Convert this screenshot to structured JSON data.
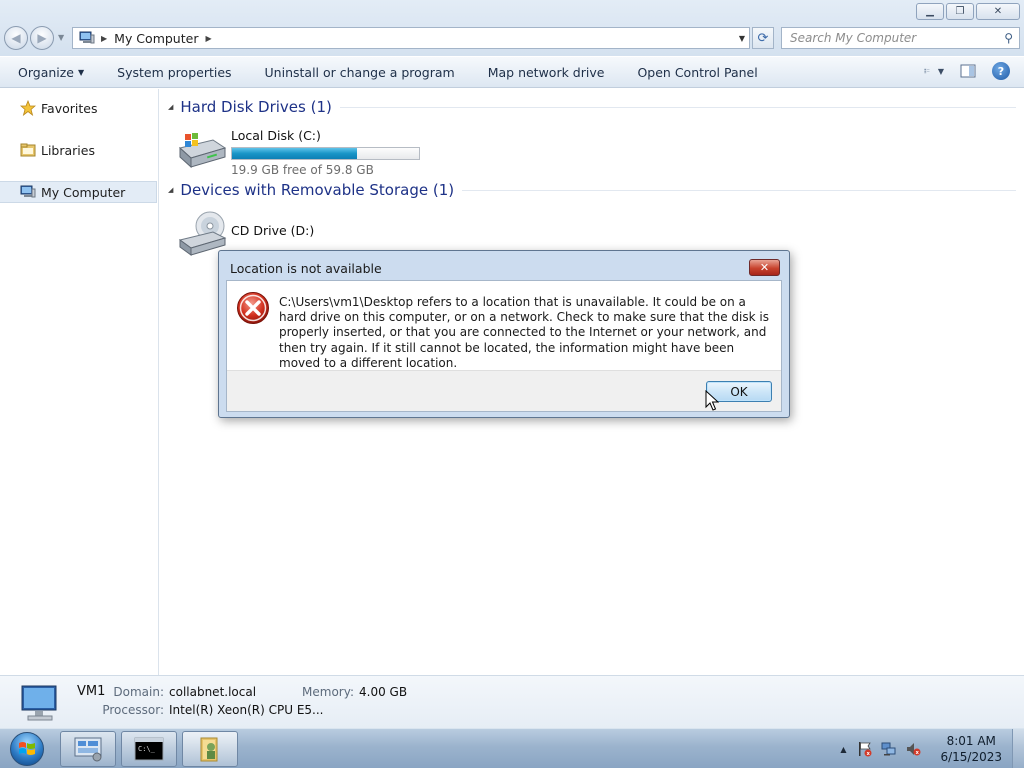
{
  "window": {
    "controls": {
      "minimize_icon": "minimize-icon",
      "restore_icon": "restore-icon",
      "close_icon": "close-icon"
    }
  },
  "address": {
    "path": "My Computer",
    "search_placeholder": "Search My Computer"
  },
  "toolbar": {
    "organize": "Organize",
    "system_properties": "System properties",
    "uninstall": "Uninstall or change a program",
    "map_drive": "Map network drive",
    "control_panel": "Open Control Panel"
  },
  "sidebar": {
    "items": [
      {
        "label": "Favorites",
        "icon": "star-icon"
      },
      {
        "label": "Libraries",
        "icon": "folder-icon"
      },
      {
        "label": "My Computer",
        "icon": "computer-icon",
        "selected": true
      }
    ]
  },
  "groups": {
    "hard_disks": {
      "title": "Hard Disk Drives (1)",
      "drives": [
        {
          "name": "Local Disk (C:)",
          "free_text": "19.9 GB free of 59.8 GB",
          "used_fraction": 0.667
        }
      ]
    },
    "removable": {
      "title": "Devices with Removable Storage (1)",
      "drives": [
        {
          "name": "CD Drive (D:)"
        }
      ]
    }
  },
  "details": {
    "name": "VM1",
    "domain_label": "Domain:",
    "domain_value": "collabnet.local",
    "memory_label": "Memory:",
    "memory_value": "4.00 GB",
    "processor_label": "Processor:",
    "processor_value": "Intel(R) Xeon(R) CPU E5..."
  },
  "dialog": {
    "title": "Location is not available",
    "message": "C:\\Users\\vm1\\Desktop refers to a location that is unavailable. It could be on a hard drive on this computer, or on a network. Check to make sure that the disk is properly inserted, or that you are connected to the Internet or your network, and then try again. If it still cannot be located, the information might have been moved to a different location.",
    "ok_label": "OK",
    "close_glyph": "✕"
  },
  "taskbar": {
    "time": "8:01 AM",
    "date": "6/15/2023"
  },
  "colors": {
    "group_title": "#1e3287",
    "drive_bar_fill": "#1895c7",
    "dialog_close": "#c8432e"
  }
}
